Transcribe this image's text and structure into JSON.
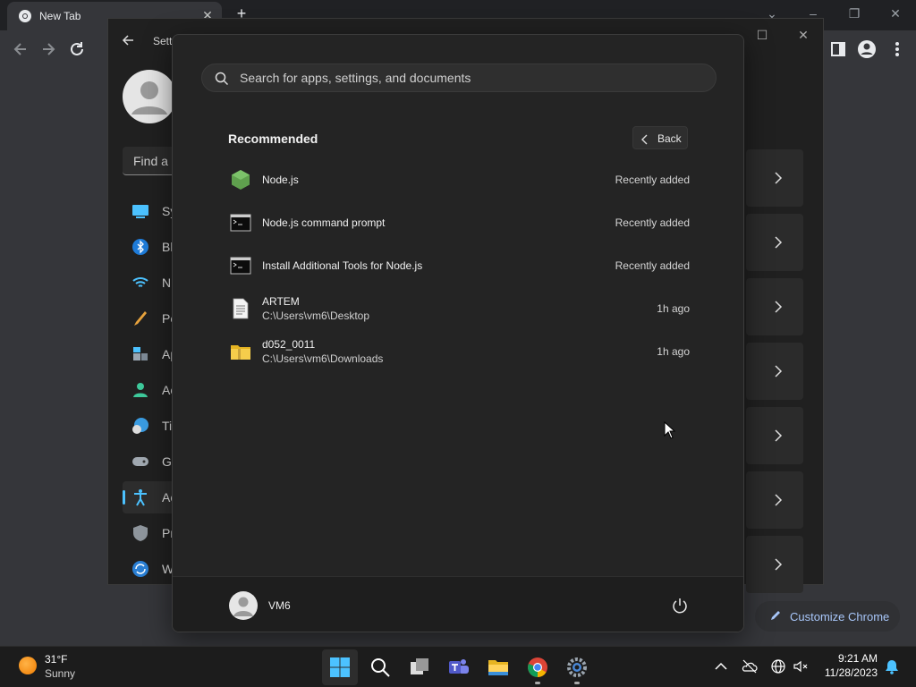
{
  "browser": {
    "tab_title": "New Tab",
    "customize_label": "Customize Chrome"
  },
  "settings": {
    "title": "Sett",
    "search_placeholder": "Find a s",
    "nav_items": [
      {
        "label": "Sy",
        "icon": "system-icon"
      },
      {
        "label": "Bl",
        "icon": "bluetooth-icon"
      },
      {
        "label": "N",
        "icon": "network-icon"
      },
      {
        "label": "Pe",
        "icon": "personalization-icon"
      },
      {
        "label": "Ap",
        "icon": "apps-icon"
      },
      {
        "label": "Ac",
        "icon": "accounts-icon"
      },
      {
        "label": "Ti",
        "icon": "time-language-icon"
      },
      {
        "label": "G",
        "icon": "gaming-icon"
      },
      {
        "label": "Ac",
        "icon": "accessibility-icon",
        "active": true
      },
      {
        "label": "Pr",
        "icon": "privacy-icon"
      },
      {
        "label": "W",
        "icon": "windows-update-icon"
      }
    ]
  },
  "start_menu": {
    "search_placeholder": "Search for apps, settings, and documents",
    "recommended_title": "Recommended",
    "back_label": "Back",
    "items": [
      {
        "name": "Node.js",
        "sub": "",
        "time": "Recently added",
        "icon": "nodejs-icon"
      },
      {
        "name": "Node.js command prompt",
        "sub": "",
        "time": "Recently added",
        "icon": "command-prompt-icon"
      },
      {
        "name": "Install Additional Tools for Node.js",
        "sub": "",
        "time": "Recently added",
        "icon": "command-prompt-icon"
      },
      {
        "name": "ARTEM",
        "sub": "C:\\Users\\vm6\\Desktop",
        "time": "1h ago",
        "icon": "text-file-icon"
      },
      {
        "name": "d052_0011",
        "sub": "C:\\Users\\vm6\\Downloads",
        "time": "1h ago",
        "icon": "zip-folder-icon"
      }
    ],
    "user_name": "VM6"
  },
  "taskbar": {
    "weather_temp": "31°F",
    "weather_desc": "Sunny",
    "time": "9:21 AM",
    "date": "11/28/2023",
    "apps": [
      "start-icon",
      "search-icon",
      "task-view-icon",
      "teams-icon",
      "file-explorer-icon",
      "chrome-icon",
      "settings-icon"
    ]
  },
  "colors": {
    "accent": "#4cc2ff",
    "start_bg": "#242424",
    "taskbar_bg": "#1c1c1c",
    "chrome_frame": "#202124",
    "customize_text": "#a8c7fa"
  }
}
